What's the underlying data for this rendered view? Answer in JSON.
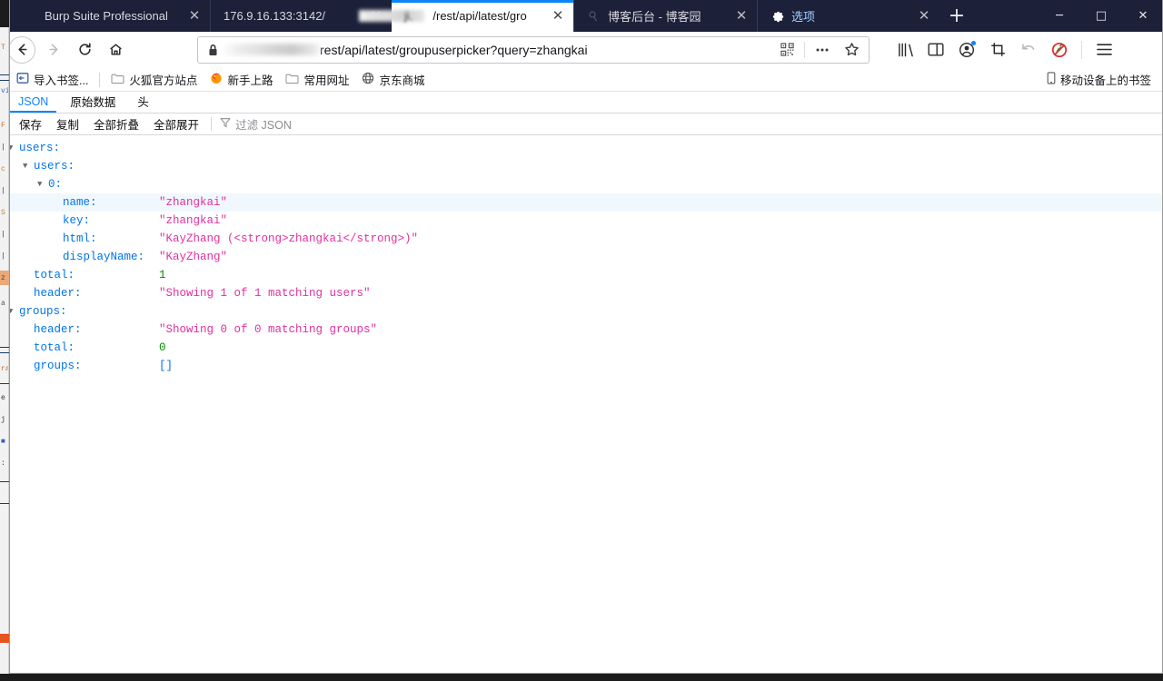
{
  "window": {
    "controls": {
      "minimize": "─",
      "maximize": "□",
      "close": "✕"
    },
    "new_tab_label": "+"
  },
  "tabs": [
    {
      "title": "Burp Suite Professional",
      "close": "✕",
      "active": false,
      "favicon": "none",
      "redacted": false
    },
    {
      "title": "176.9.16.133:3142/",
      "close": "✕",
      "active": false,
      "favicon": "none",
      "redacted": false
    },
    {
      "title": "/rest/api/latest/gro",
      "prefix": "ji.",
      "close": "✕",
      "active": true,
      "favicon": "none",
      "redacted": true
    },
    {
      "title": "博客后台 - 博客园",
      "close": "✕",
      "active": false,
      "favicon": "blog-favicon",
      "redacted": false
    },
    {
      "title": "选项",
      "close": "✕",
      "active": false,
      "favicon": "gear-icon",
      "redacted": false
    }
  ],
  "nav": {
    "back": "back-arrow-icon",
    "forward": "forward-arrow-icon",
    "reload": "reload-icon",
    "home": "home-icon"
  },
  "urlbar": {
    "lock": "lock-icon",
    "redacted_prefix": true,
    "url_text": "rest/api/latest/groupuserpicker?query=zhangkai",
    "qr_icon": "qr-code-icon",
    "more_icon": "ellipsis-icon",
    "bookmark_icon": "star-icon"
  },
  "toolbar_right": {
    "library": "library-icon",
    "sidebar": "sidebar-icon",
    "account": "account-icon",
    "screenshot": "screenshot-icon",
    "undo": "undo-icon",
    "blocked": "blocked-icon",
    "menu": "hamburger-menu-icon"
  },
  "bookmarks": {
    "import": {
      "label": "导入书签...",
      "icon": "import-icon"
    },
    "items": [
      {
        "label": "火狐官方站点",
        "icon": "folder-icon"
      },
      {
        "label": "新手上路",
        "icon": "firefox-icon"
      },
      {
        "label": "常用网址",
        "icon": "folder-icon"
      },
      {
        "label": "京东商城",
        "icon": "globe-icon"
      }
    ],
    "mobile": {
      "label": "移动设备上的书签",
      "icon": "mobile-icon"
    }
  },
  "json_viewer": {
    "tabs": [
      {
        "label": "JSON",
        "active": true
      },
      {
        "label": "原始数据",
        "active": false
      },
      {
        "label": "头",
        "active": false
      }
    ],
    "toolbar": {
      "save": "保存",
      "copy": "复制",
      "collapse_all": "全部折叠",
      "expand_all": "全部展开",
      "filter_icon": "filter-icon",
      "filter_placeholder": "过滤 JSON"
    },
    "rows": [
      {
        "indent": 0,
        "tri": "▼",
        "key": "users:",
        "value": "",
        "type": "none",
        "highlight": false
      },
      {
        "indent": 1,
        "tri": "▼",
        "key": "users:",
        "value": "",
        "type": "none",
        "highlight": false
      },
      {
        "indent": 2,
        "tri": "▼",
        "key": "0:",
        "value": "",
        "type": "none",
        "highlight": false
      },
      {
        "indent": 3,
        "tri": "",
        "key": "name:",
        "value": "\"zhangkai\"",
        "type": "str",
        "highlight": true
      },
      {
        "indent": 3,
        "tri": "",
        "key": "key:",
        "value": "\"zhangkai\"",
        "type": "str",
        "highlight": false
      },
      {
        "indent": 3,
        "tri": "",
        "key": "html:",
        "value": "\"KayZhang (<strong>zhangkai</strong>)\"",
        "type": "str",
        "highlight": false
      },
      {
        "indent": 3,
        "tri": "",
        "key": "displayName:",
        "value": "\"KayZhang\"",
        "type": "str",
        "highlight": false
      },
      {
        "indent": 1,
        "tri": "",
        "key": "total:",
        "value": "1",
        "type": "num",
        "highlight": false
      },
      {
        "indent": 1,
        "tri": "",
        "key": "header:",
        "value": "\"Showing 1 of 1 matching users\"",
        "type": "str",
        "highlight": false
      },
      {
        "indent": 0,
        "tri": "▼",
        "key": "groups:",
        "value": "",
        "type": "none",
        "highlight": false
      },
      {
        "indent": 1,
        "tri": "",
        "key": "header:",
        "value": "\"Showing 0 of 0 matching groups\"",
        "type": "str",
        "highlight": false
      },
      {
        "indent": 1,
        "tri": "",
        "key": "total:",
        "value": "0",
        "type": "num",
        "highlight": false
      },
      {
        "indent": 1,
        "tri": "",
        "key": "groups:",
        "value": "[]",
        "type": "arr",
        "highlight": false
      }
    ]
  },
  "colors": {
    "tabstrip_bg": "#1c2038",
    "accent_blue": "#0a84ff",
    "json_key": "#0074e8",
    "json_string": "#e0309f",
    "json_number": "#058b00",
    "row_highlight": "#f0f8fe"
  }
}
